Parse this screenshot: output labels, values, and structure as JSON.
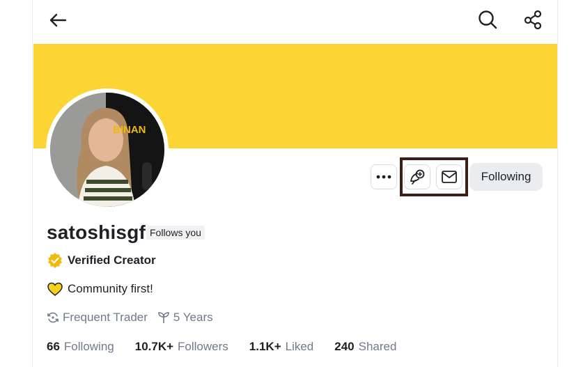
{
  "header": {
    "back_icon": "arrow-left-icon",
    "search_icon": "search-icon",
    "share_icon": "share-icon"
  },
  "banner": {
    "color": "#fcd535"
  },
  "avatar": {
    "logo_text": "BINAN"
  },
  "actions": {
    "more_icon": "more-dots-icon",
    "tip_icon": "tip-icon",
    "message_icon": "mail-icon",
    "follow_label": "Following"
  },
  "profile": {
    "username": "satoshisgf",
    "follows_you": "Follows you",
    "verified_label": "Verified Creator",
    "bio": "Community first!",
    "tag_trader": "Frequent Trader",
    "tag_years": "5 Years"
  },
  "stats": [
    {
      "value": "66",
      "label": "Following"
    },
    {
      "value": "10.7K+",
      "label": "Followers"
    },
    {
      "value": "1.1K+",
      "label": "Liked"
    },
    {
      "value": "240",
      "label": "Shared"
    }
  ],
  "colors": {
    "accent": "#fcd535",
    "verified_badge": "#f0b90b",
    "highlight_box": "#3b1e16"
  }
}
